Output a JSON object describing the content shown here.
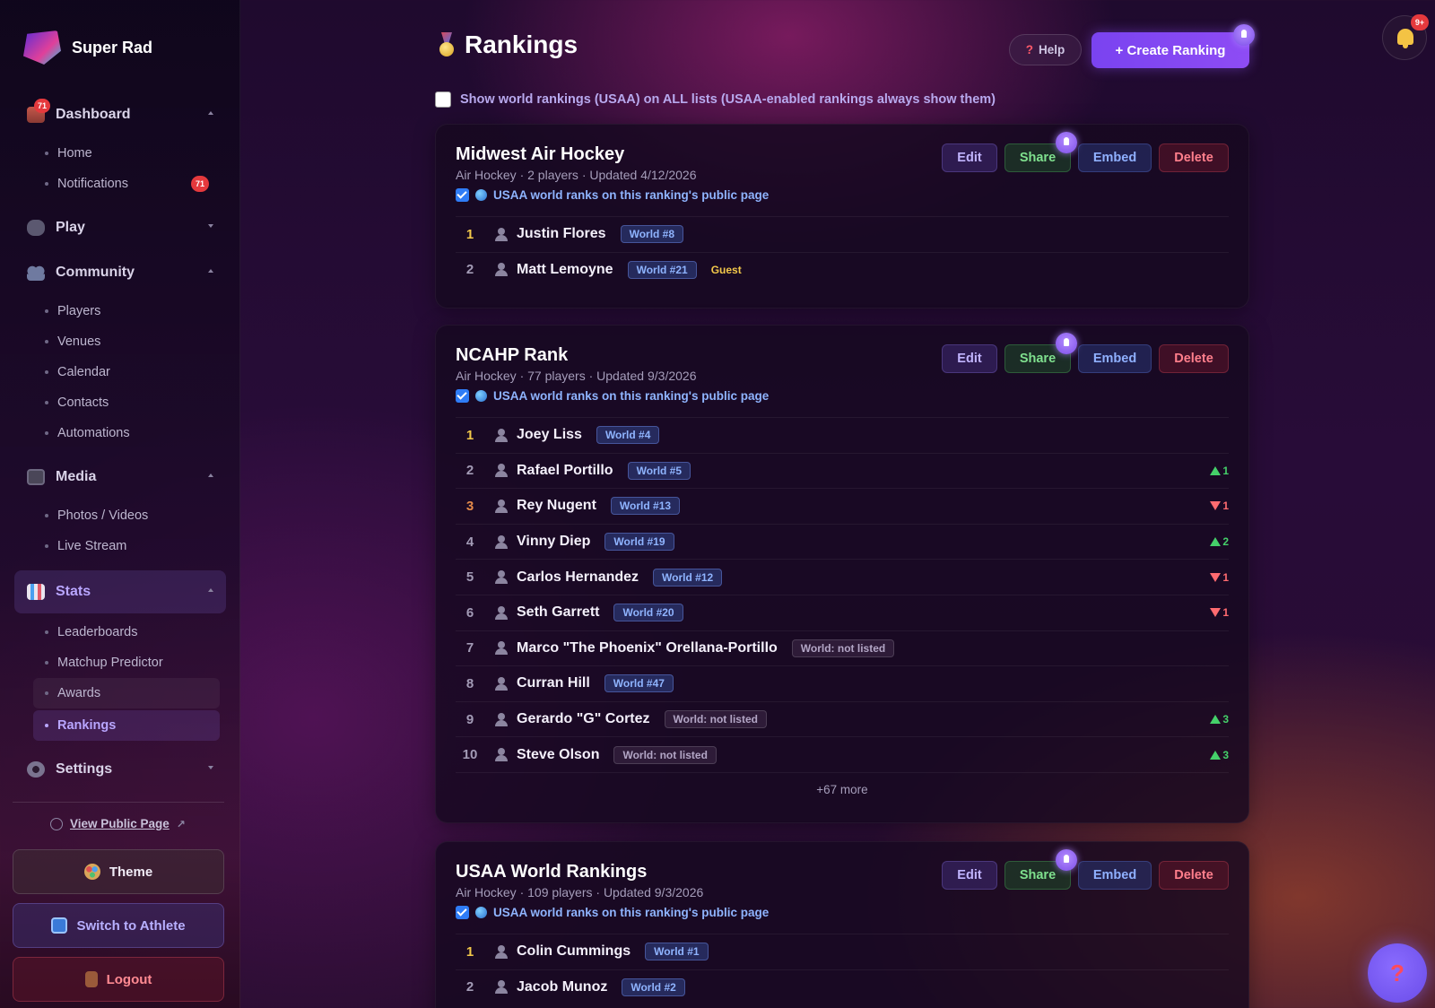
{
  "brand": {
    "name": "Super Rad"
  },
  "sidebar": {
    "groups": [
      {
        "label": "Dashboard",
        "icon": "dashboard-icon",
        "badge": "71",
        "expanded": true,
        "items": [
          {
            "label": "Home"
          },
          {
            "label": "Notifications",
            "badge": "71"
          }
        ]
      },
      {
        "label": "Play",
        "icon": "gamepad-icon",
        "expanded": false,
        "items": []
      },
      {
        "label": "Community",
        "icon": "people-icon",
        "expanded": true,
        "items": [
          {
            "label": "Players"
          },
          {
            "label": "Venues"
          },
          {
            "label": "Calendar"
          },
          {
            "label": "Contacts"
          },
          {
            "label": "Automations"
          }
        ]
      },
      {
        "label": "Media",
        "icon": "tv-icon",
        "expanded": true,
        "items": [
          {
            "label": "Photos / Videos"
          },
          {
            "label": "Live Stream"
          }
        ]
      },
      {
        "label": "Stats",
        "icon": "bar-chart-icon",
        "expanded": true,
        "active": true,
        "items": [
          {
            "label": "Leaderboards"
          },
          {
            "label": "Matchup Predictor"
          },
          {
            "label": "Awards"
          },
          {
            "label": "Rankings",
            "active": true
          }
        ]
      },
      {
        "label": "Settings",
        "icon": "gear-icon",
        "expanded": false,
        "items": []
      }
    ],
    "public_link": "View Public Page",
    "theme_label": "Theme",
    "switch_label": "Switch to Athlete",
    "logout_label": "Logout"
  },
  "header": {
    "title": "Rankings",
    "help_label": "Help",
    "create_label": "+ Create Ranking",
    "notif_badge": "9+",
    "world_toggle_label": "Show world rankings (USAA) on ALL lists (USAA-enabled rankings always show them)",
    "world_toggle_checked": false
  },
  "actions": {
    "edit": "Edit",
    "share": "Share",
    "embed": "Embed",
    "delete": "Delete"
  },
  "rankings": [
    {
      "title": "Midwest Air Hockey",
      "meta": "Air Hockey · 2 players · Updated 4/12/2026",
      "usaa_label": "USAA world ranks on this ranking's public page",
      "players": [
        {
          "rank": "1",
          "name": "Justin Flores",
          "world": "World #8"
        },
        {
          "rank": "2",
          "name": "Matt Lemoyne",
          "world": "World #21",
          "tag": "Guest"
        }
      ]
    },
    {
      "title": "NCAHP Rank",
      "meta": "Air Hockey · 77 players · Updated 9/3/2026",
      "usaa_label": "USAA world ranks on this ranking's public page",
      "players": [
        {
          "rank": "1",
          "name": "Joey Liss",
          "world": "World #4"
        },
        {
          "rank": "2",
          "name": "Rafael Portillo",
          "world": "World #5",
          "move": "up",
          "delta": "1"
        },
        {
          "rank": "3",
          "name": "Rey Nugent",
          "world": "World #13",
          "move": "down",
          "delta": "1"
        },
        {
          "rank": "4",
          "name": "Vinny Diep",
          "world": "World #19",
          "move": "up",
          "delta": "2"
        },
        {
          "rank": "5",
          "name": "Carlos Hernandez",
          "world": "World #12",
          "move": "down",
          "delta": "1"
        },
        {
          "rank": "6",
          "name": "Seth Garrett",
          "world": "World #20",
          "move": "down",
          "delta": "1"
        },
        {
          "rank": "7",
          "name": "Marco \"The Phoenix\" Orellana-Portillo",
          "world": "World: not listed"
        },
        {
          "rank": "8",
          "name": "Curran Hill",
          "world": "World #47"
        },
        {
          "rank": "9",
          "name": "Gerardo \"G\" Cortez",
          "world": "World: not listed",
          "move": "up",
          "delta": "3"
        },
        {
          "rank": "10",
          "name": "Steve Olson",
          "world": "World: not listed",
          "move": "up",
          "delta": "3"
        }
      ],
      "more": "+67 more"
    },
    {
      "title": "USAA World Rankings",
      "meta": "Air Hockey · 109 players · Updated 9/3/2026",
      "usaa_label": "USAA world ranks on this ranking's public page",
      "players": [
        {
          "rank": "1",
          "name": "Colin Cummings",
          "world": "World #1"
        },
        {
          "rank": "2",
          "name": "Jacob Munoz",
          "world": "World #2"
        }
      ]
    }
  ],
  "fab": {
    "label": "?"
  }
}
